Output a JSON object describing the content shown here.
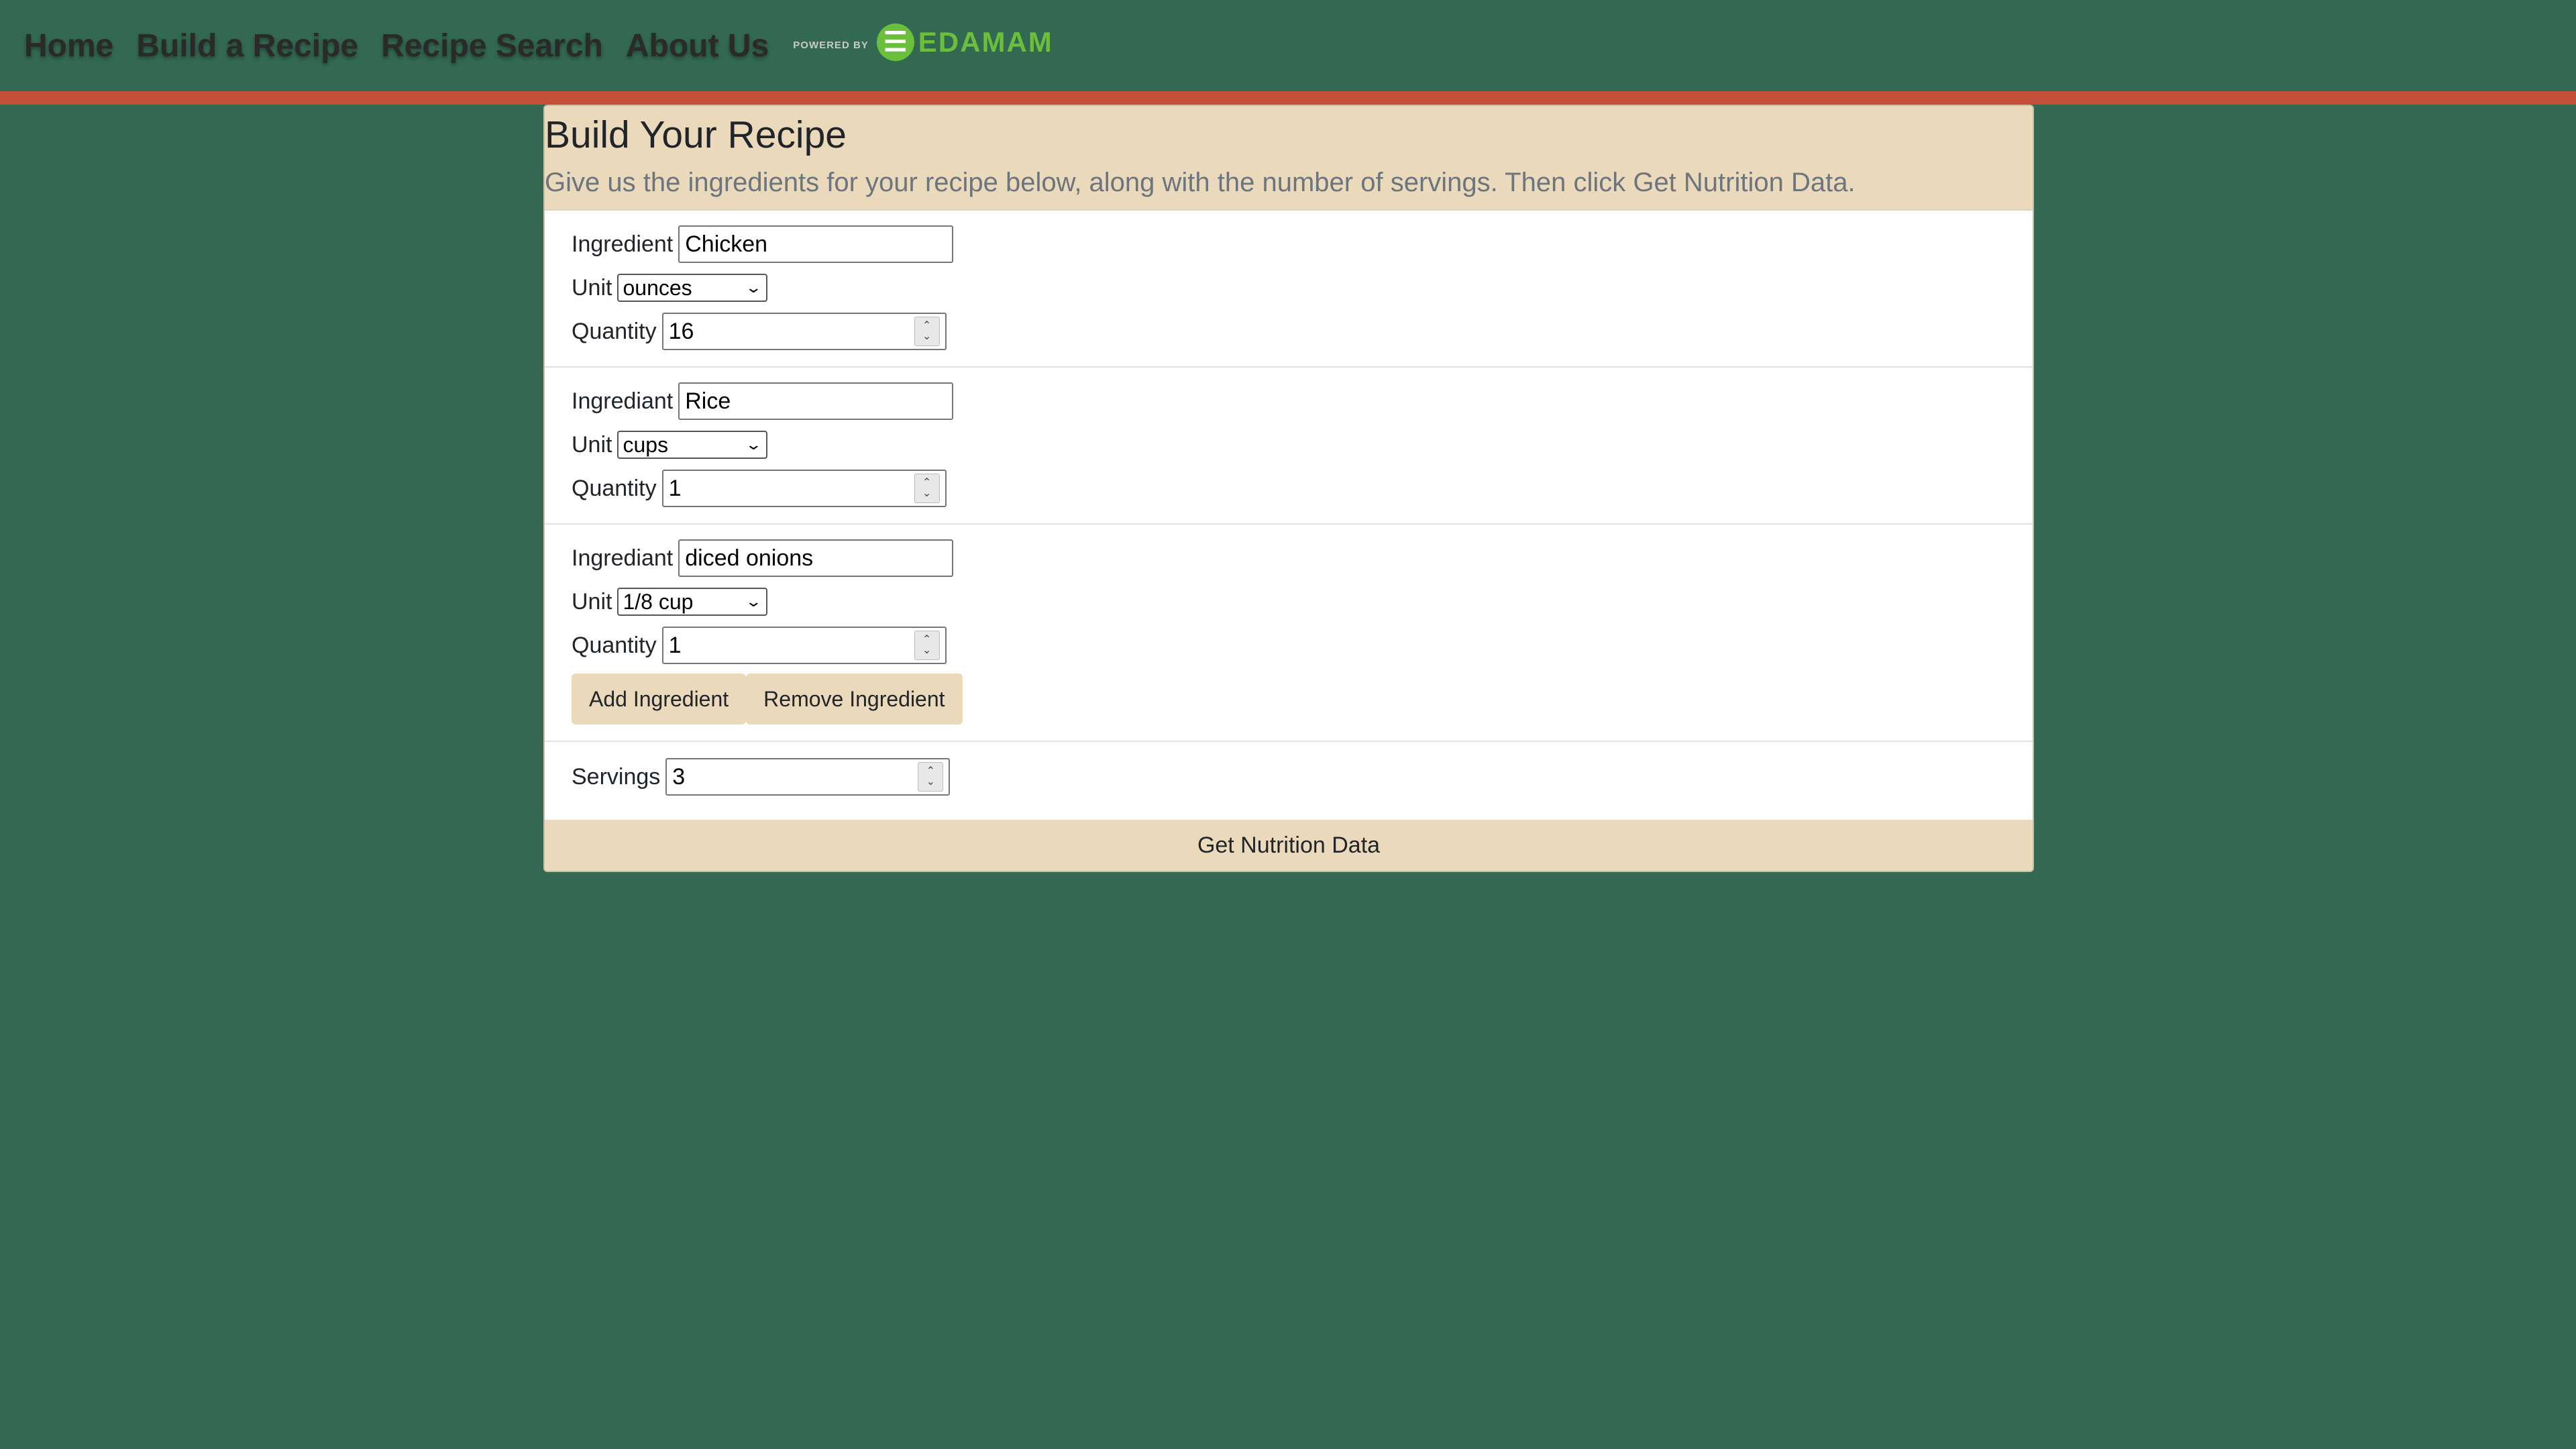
{
  "nav": {
    "links": [
      "Home",
      "Build a Recipe",
      "Recipe Search",
      "About Us"
    ],
    "powered_by": "POWERED BY",
    "brand": "EDAMAM"
  },
  "card": {
    "title": "Build Your Recipe",
    "subtitle": "Give us the ingredients for your recipe below, along with the number of servings. Then click Get Nutrition Data."
  },
  "ingredients": [
    {
      "label": "Ingredient",
      "value": "Chicken",
      "unit_label": "Unit",
      "unit": "ounces",
      "qty_label": "Quantity",
      "qty": "16"
    },
    {
      "label": "Ingrediant",
      "value": "Rice",
      "unit_label": "Unit",
      "unit": "cups",
      "qty_label": "Quantity",
      "qty": "1"
    },
    {
      "label": "Ingrediant",
      "value": "diced onions",
      "unit_label": "Unit",
      "unit": "1/8 cup",
      "qty_label": "Quantity",
      "qty": "1"
    }
  ],
  "buttons": {
    "add": "Add Ingredient",
    "remove": "Remove Ingredient",
    "submit": "Get Nutrition Data"
  },
  "servings": {
    "label": "Servings",
    "value": "3"
  },
  "colors": {
    "background": "#336952",
    "accent_stripe": "#c4503a",
    "card_header": "#ebd9bb",
    "brand_green": "#6cbf3d"
  }
}
